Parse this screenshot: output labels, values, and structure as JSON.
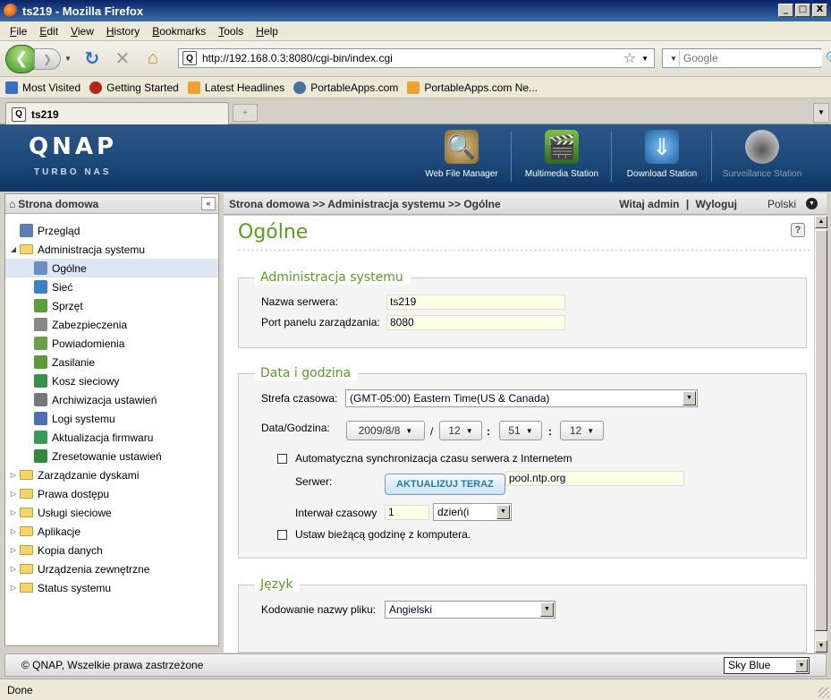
{
  "window": {
    "title": "ts219 - Mozilla Firefox",
    "minimize": "_",
    "maximize": "□",
    "close": "X"
  },
  "menu": [
    {
      "label": "File",
      "accel": "F",
      "rest": "ile"
    },
    {
      "label": "Edit",
      "accel": "E",
      "rest": "dit"
    },
    {
      "label": "View",
      "accel": "V",
      "rest": "iew"
    },
    {
      "label": "History",
      "accel": "H",
      "rest": "istory"
    },
    {
      "label": "Bookmarks",
      "accel": "B",
      "rest": "ookmarks"
    },
    {
      "label": "Tools",
      "accel": "T",
      "rest": "ools"
    },
    {
      "label": "Help",
      "accel": "H",
      "rest": "elp"
    }
  ],
  "nav": {
    "url": "http://192.168.0.3:8080/cgi-bin/index.cgi",
    "search_placeholder": "Google"
  },
  "bookmarks": [
    {
      "label": "Most Visited",
      "icon": "most-visited-icon",
      "color": "#3b6fc4"
    },
    {
      "label": "Getting Started",
      "icon": "firefox-red-icon",
      "color": "#b3251b"
    },
    {
      "label": "Latest Headlines",
      "icon": "rss-icon",
      "color": "#f0a030"
    },
    {
      "label": "PortableApps.com",
      "icon": "portableapps-icon",
      "color": "#4c6f9e"
    },
    {
      "label": "PortableApps.com Ne...",
      "icon": "rss-icon",
      "color": "#f0a030"
    }
  ],
  "tab": {
    "label": "ts219"
  },
  "qnap": {
    "logo": "QNAP",
    "subtitle": "TURBO NAS",
    "stations": [
      {
        "label": "Web File Manager",
        "icon": "magnifier-icon",
        "enabled": true
      },
      {
        "label": "Multimedia Station",
        "icon": "multimedia-icon",
        "enabled": true
      },
      {
        "label": "Download Station",
        "icon": "download-icon",
        "enabled": true
      },
      {
        "label": "Surveillance Station",
        "icon": "camera-icon",
        "enabled": false
      }
    ]
  },
  "sidebar": {
    "title": "Strona domowa",
    "items": [
      {
        "label": "Przegląd",
        "level": 0,
        "type": "leaf",
        "icon": "overview-icon"
      },
      {
        "label": "Administracja systemu",
        "level": 0,
        "type": "folder",
        "expanded": true
      },
      {
        "label": "Ogólne",
        "level": 1,
        "type": "leaf",
        "icon": "general-icon",
        "selected": true
      },
      {
        "label": "Sieć",
        "level": 1,
        "type": "leaf",
        "icon": "network-icon"
      },
      {
        "label": "Sprzęt",
        "level": 1,
        "type": "leaf",
        "icon": "hardware-icon"
      },
      {
        "label": "Zabezpieczenia",
        "level": 1,
        "type": "leaf",
        "icon": "security-icon"
      },
      {
        "label": "Powiadomienia",
        "level": 1,
        "type": "leaf",
        "icon": "notification-icon"
      },
      {
        "label": "Zasilanie",
        "level": 1,
        "type": "leaf",
        "icon": "power-icon"
      },
      {
        "label": "Kosz sieciowy",
        "level": 1,
        "type": "leaf",
        "icon": "recycle-bin-icon"
      },
      {
        "label": "Archiwizacja ustawień",
        "level": 1,
        "type": "leaf",
        "icon": "backup-settings-icon"
      },
      {
        "label": "Logi systemu",
        "level": 1,
        "type": "leaf",
        "icon": "logs-icon"
      },
      {
        "label": "Aktualizacja firmwaru",
        "level": 1,
        "type": "leaf",
        "icon": "firmware-icon"
      },
      {
        "label": "Zresetowanie ustawień",
        "level": 1,
        "type": "leaf",
        "icon": "reset-icon"
      },
      {
        "label": "Zarządzanie dyskami",
        "level": 0,
        "type": "folder",
        "expanded": false
      },
      {
        "label": "Prawa dostępu",
        "level": 0,
        "type": "folder",
        "expanded": false
      },
      {
        "label": "Usługi sieciowe",
        "level": 0,
        "type": "folder",
        "expanded": false
      },
      {
        "label": "Aplikacje",
        "level": 0,
        "type": "folder",
        "expanded": false
      },
      {
        "label": "Kopia danych",
        "level": 0,
        "type": "folder",
        "expanded": false
      },
      {
        "label": "Urządzenia zewnętrzne",
        "level": 0,
        "type": "folder",
        "expanded": false
      },
      {
        "label": "Status systemu",
        "level": 0,
        "type": "folder",
        "expanded": false
      }
    ]
  },
  "content_header": {
    "breadcrumb": "Strona domowa >> Administracja systemu >> Ogólne",
    "welcome": "Witaj admin",
    "separator": "|",
    "logout": "Wyloguj",
    "language": "Polski"
  },
  "page": {
    "title": "Ogólne",
    "help": "?",
    "admin": {
      "legend": "Administracja systemu",
      "server_name_label": "Nazwa serwera:",
      "server_name_value": "ts219",
      "port_label": "Port panelu zarządzania:",
      "port_value": "8080"
    },
    "datetime": {
      "legend": "Data i godzina",
      "timezone_label": "Strefa czasowa:",
      "timezone_value": "(GMT-05:00) Eastern Time(US & Canada)",
      "datetime_label": "Data/Godzina:",
      "date_value": "2009/8/8",
      "date_sep": "/",
      "hour_value": "12",
      "time_sep_1": ":",
      "minute_value": "51",
      "time_sep_2": ":",
      "second_value": "12",
      "auto_sync_label": "Automatyczna synchronizacja czasu serwera z Internetem",
      "server_label": "Serwer:",
      "update_button": "AKTUALIZUJ TERAZ",
      "server_value": "pool.ntp.org",
      "interval_label": "Interwał czasowy",
      "interval_value": "1",
      "interval_unit": "dzień(i",
      "set_from_pc_label": "Ustaw bieżącą godzinę z komputera."
    },
    "language": {
      "legend": "Język",
      "encoding_label": "Kodowanie nazwy pliku:",
      "encoding_value": "Angielski"
    }
  },
  "footer": {
    "copyright": "© QNAP, Wszelkie prawa zastrzeżone",
    "theme": "Sky Blue"
  },
  "status": {
    "text": "Done"
  }
}
